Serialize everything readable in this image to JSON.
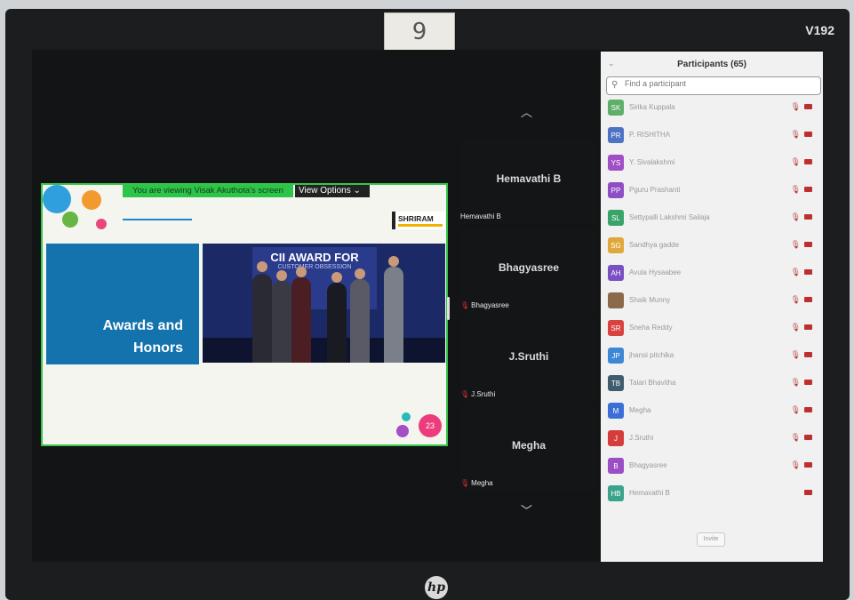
{
  "device": {
    "sticker_text": "9",
    "model_label": "V192",
    "brand_logo": "hp"
  },
  "share": {
    "banner_text": "You are viewing Visak Akuthota's screen",
    "view_options_label": "View Options ⌄",
    "slide": {
      "heading_line1": "Awards and",
      "heading_line2": "Honors",
      "brand_text": "SHRIRAM",
      "photo_caption": "CII AWARD FOR",
      "photo_subcaption": "CUSTOMER OBSESSION",
      "page_number": "23"
    }
  },
  "video_strip": {
    "scroll_up_icon": "chevron-up-icon",
    "scroll_down_icon": "chevron-down-icon",
    "tiles": [
      {
        "display_name": "Hemavathi B",
        "label": "Hemavathi B",
        "muted": false
      },
      {
        "display_name": "Bhagyasree",
        "label": "Bhagyasree",
        "muted": true
      },
      {
        "display_name": "J.Sruthi",
        "label": "J.Sruthi",
        "muted": true
      },
      {
        "display_name": "Megha",
        "label": "Megha",
        "muted": true
      }
    ]
  },
  "participants": {
    "title": "Participants (65)",
    "search_placeholder": "Find a participant",
    "invite_label": "Invite",
    "list": [
      {
        "initials": "SK",
        "name": "Sirika Kuppala",
        "color": "#5fae6a"
      },
      {
        "initials": "PR",
        "name": "P. RISHITHA",
        "color": "#4f73c4"
      },
      {
        "initials": "YS",
        "name": "Y. Sivalakshmi",
        "color": "#a04fc4"
      },
      {
        "initials": "PP",
        "name": "Pguru Prashanti",
        "color": "#8f4fc4"
      },
      {
        "initials": "SL",
        "name": "Settypalli Lakshmi Sailaja",
        "color": "#3aa36a"
      },
      {
        "initials": "SG",
        "name": "Sandhya gadde",
        "color": "#e0a83a"
      },
      {
        "initials": "AH",
        "name": "Avula Hysaabee",
        "color": "#7a4fc4"
      },
      {
        "initials": "",
        "name": "Shaik Munny",
        "color": "#8a6a4a"
      },
      {
        "initials": "SR",
        "name": "Sneha Reddy",
        "color": "#d8433f"
      },
      {
        "initials": "JP",
        "name": "jhansi pitchika",
        "color": "#3c87d6"
      },
      {
        "initials": "TB",
        "name": "Talari Bhavitha",
        "color": "#3f5d6c"
      },
      {
        "initials": "M",
        "name": "Megha",
        "color": "#3c6fd6"
      },
      {
        "initials": "J",
        "name": "J.Sruthi",
        "color": "#d53c3c"
      },
      {
        "initials": "B",
        "name": "Bhagyasree",
        "color": "#9b4fc4"
      },
      {
        "initials": "HB",
        "name": "Hemavathi B",
        "color": "#3aa38a"
      }
    ]
  }
}
